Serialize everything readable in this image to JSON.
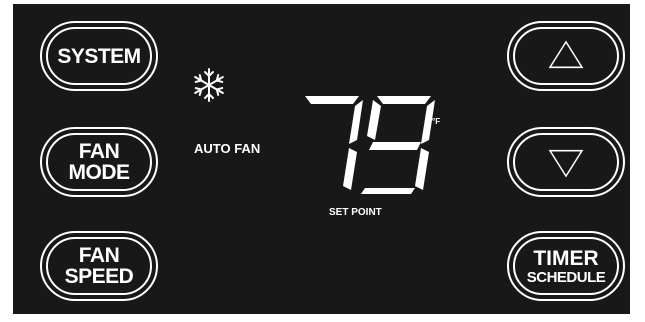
{
  "buttons": {
    "system": "SYSTEM",
    "fan_mode": "FAN\nMODE",
    "fan_speed": "FAN\nSPEED",
    "timer_line1": "TIMER",
    "timer_line2": "SCHEDULE"
  },
  "display": {
    "mode_icon": "snowflake-icon",
    "fan_status": "AUTO FAN",
    "temperature": "79",
    "unit": "°F",
    "caption": "SET POINT"
  },
  "icons": {
    "up": "up-triangle-icon",
    "down": "down-triangle-icon"
  },
  "colors": {
    "panel": "#181818",
    "foreground": "#ffffff"
  }
}
